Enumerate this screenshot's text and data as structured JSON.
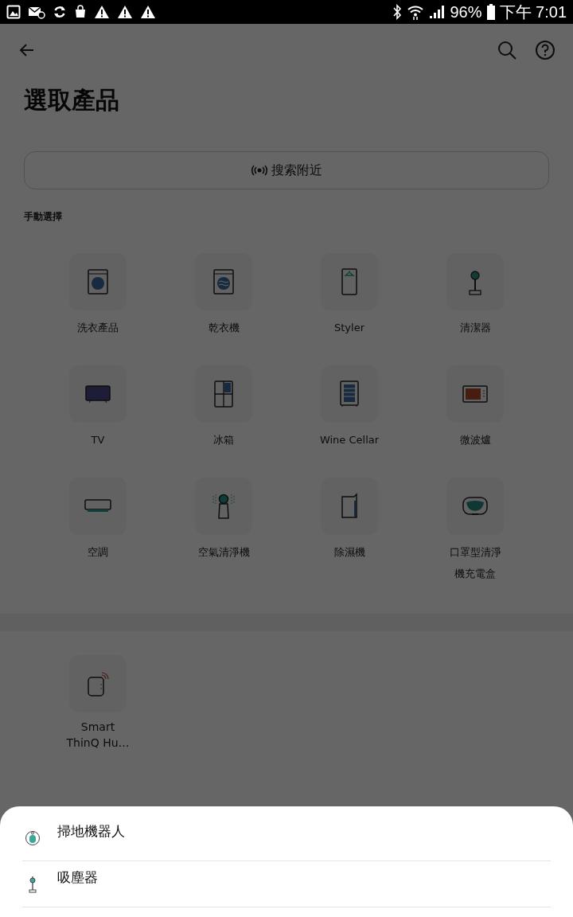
{
  "status_bar": {
    "battery": "96%",
    "time": "下午 7:01"
  },
  "page": {
    "title": "選取產品",
    "scan_button": "搜索附近",
    "section_label": "手動選擇"
  },
  "products": [
    {
      "label": "洗衣產品"
    },
    {
      "label": "乾衣機"
    },
    {
      "label": "Styler"
    },
    {
      "label": "清潔器"
    },
    {
      "label": "TV"
    },
    {
      "label": "冰箱"
    },
    {
      "label": "Wine Cellar"
    },
    {
      "label": "微波爐"
    },
    {
      "label": "空調"
    },
    {
      "label": "空氣清淨機"
    },
    {
      "label": "除濕機"
    },
    {
      "label": "口罩型清淨機充電盒"
    }
  ],
  "other_products": [
    {
      "label": "Smart ThinQ Hu…"
    }
  ],
  "sheet": {
    "items": [
      {
        "label": "掃地機器人"
      },
      {
        "label": "吸塵器"
      }
    ]
  }
}
